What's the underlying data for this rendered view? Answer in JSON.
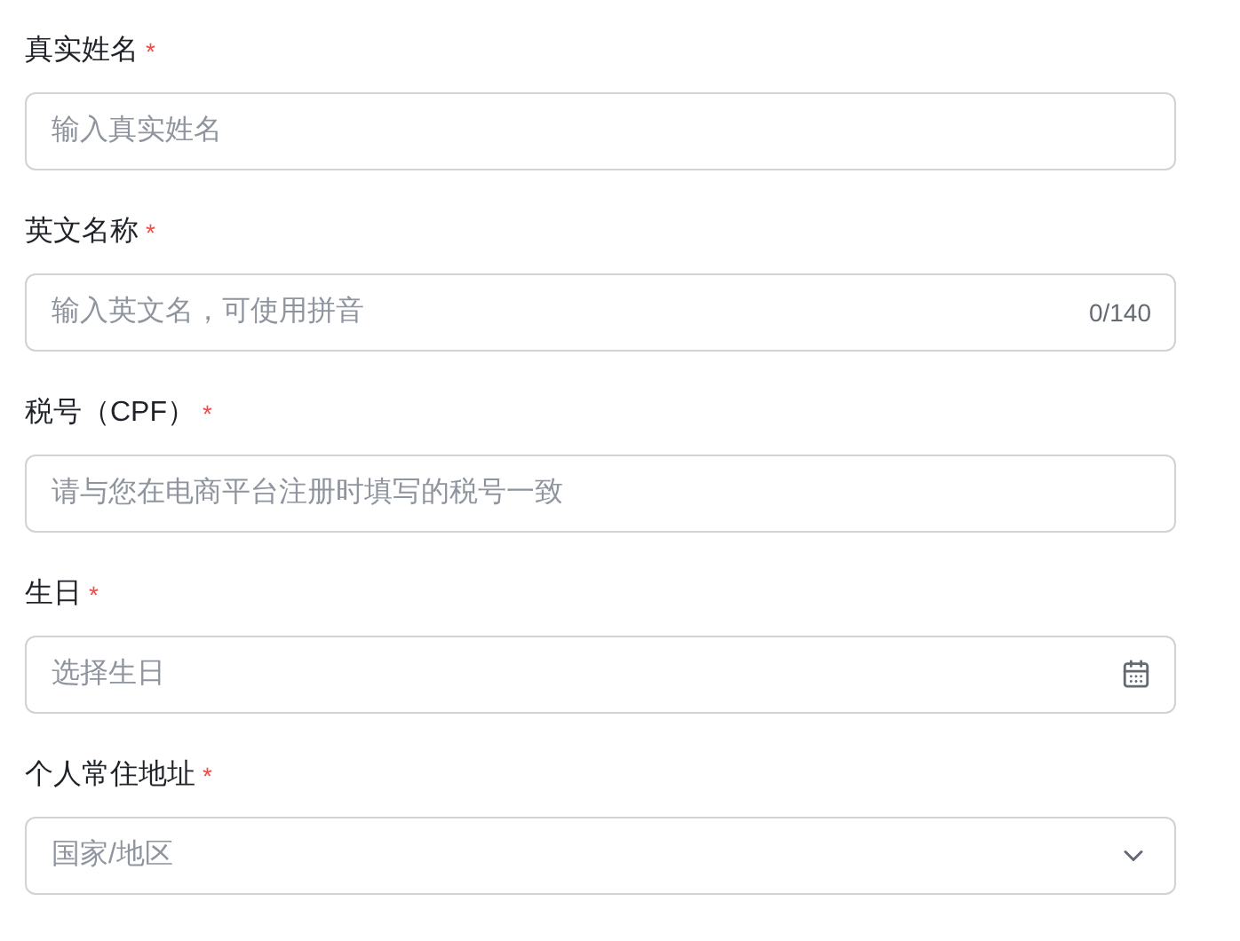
{
  "fields": [
    {
      "label": "真实姓名",
      "required_mark": "*",
      "kind": "text",
      "placeholder": "输入真实姓名"
    },
    {
      "label": "英文名称",
      "required_mark": "*",
      "kind": "text",
      "placeholder": "输入英文名，可使用拼音",
      "counter": "0/140"
    },
    {
      "label": "税号（CPF）",
      "required_mark": "*",
      "kind": "text",
      "placeholder": "请与您在电商平台注册时填写的税号一致"
    },
    {
      "label": "生日",
      "required_mark": "*",
      "kind": "date",
      "placeholder": "选择生日"
    },
    {
      "label": "个人常住地址",
      "required_mark": "*",
      "kind": "select",
      "placeholder": "国家/地区"
    }
  ]
}
